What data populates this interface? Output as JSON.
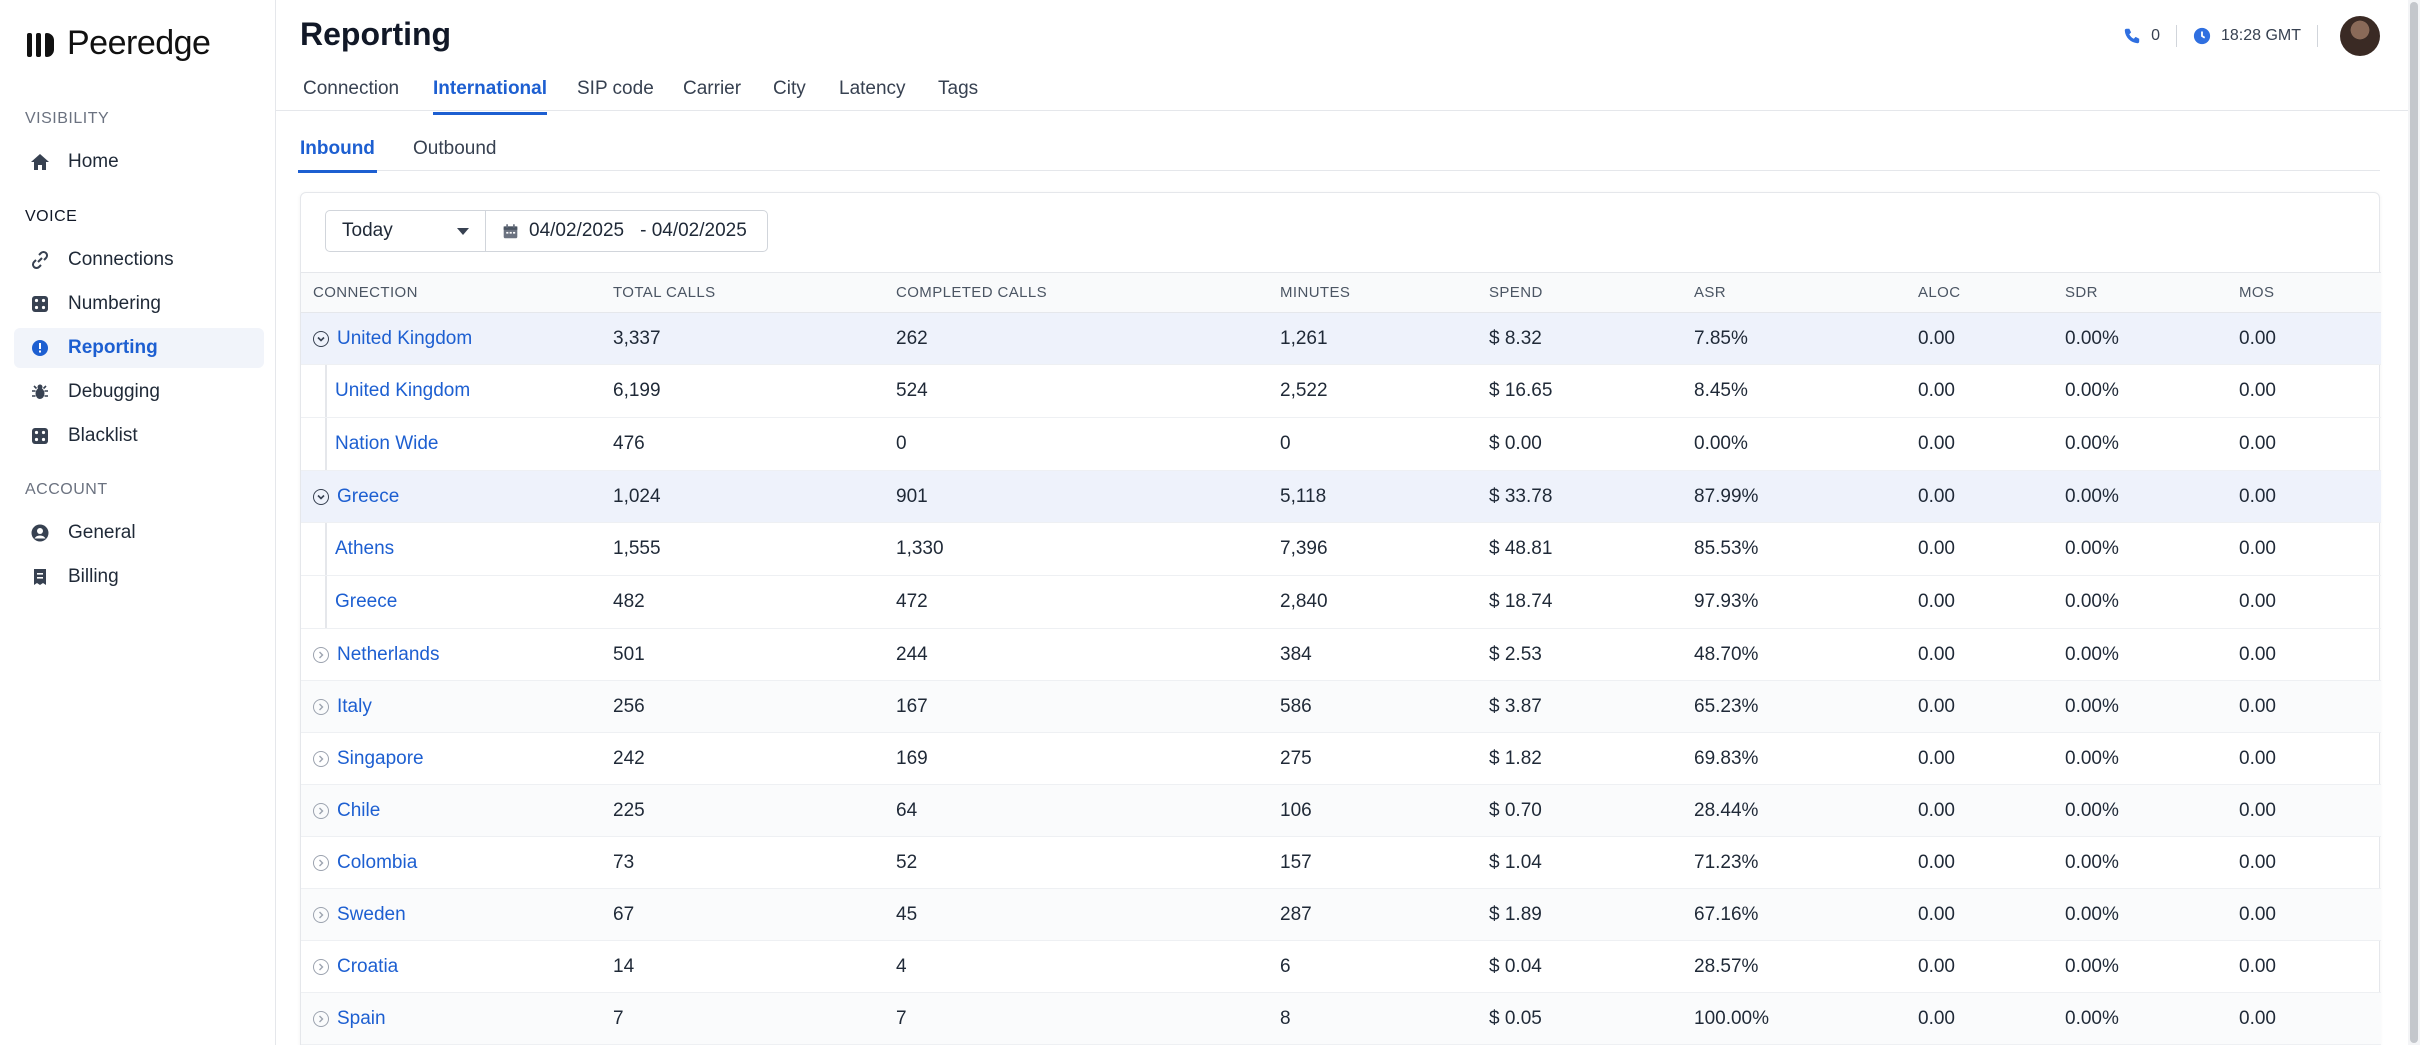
{
  "app": {
    "name": "Peeredge"
  },
  "sidebar": {
    "sections": [
      {
        "label": "VISIBILITY",
        "items": [
          {
            "label": "Home",
            "icon": "home-icon"
          }
        ]
      },
      {
        "label": "VOICE",
        "items": [
          {
            "label": "Connections",
            "icon": "link-icon"
          },
          {
            "label": "Numbering",
            "icon": "dice-icon"
          },
          {
            "label": "Reporting",
            "icon": "alert-circle-icon",
            "active": true
          },
          {
            "label": "Debugging",
            "icon": "bug-icon"
          },
          {
            "label": "Blacklist",
            "icon": "dice-icon"
          }
        ]
      },
      {
        "label": "ACCOUNT",
        "items": [
          {
            "label": "General",
            "icon": "user-circle-icon"
          },
          {
            "label": "Billing",
            "icon": "receipt-icon"
          }
        ]
      }
    ]
  },
  "header": {
    "title": "Reporting",
    "calls_count": "0",
    "time": "18:28 GMT"
  },
  "tabs": [
    {
      "label": "Connection"
    },
    {
      "label": "International",
      "active": true
    },
    {
      "label": "SIP code"
    },
    {
      "label": "Carrier"
    },
    {
      "label": "City"
    },
    {
      "label": "Latency"
    },
    {
      "label": "Tags"
    }
  ],
  "subtabs": [
    {
      "label": "Inbound",
      "active": true
    },
    {
      "label": "Outbound"
    }
  ],
  "filters": {
    "period": "Today",
    "date_from": "04/02/2025",
    "date_to": "- 04/02/2025"
  },
  "table": {
    "columns": [
      "Connection",
      "Total Calls",
      "Completed Calls",
      "Minutes",
      "Spend",
      "ASR",
      "ALOC",
      "SDR",
      "MOS"
    ],
    "rows": [
      {
        "kind": "parent",
        "expanded": true,
        "cells": [
          "United Kingdom",
          "3,337",
          "262",
          "1,261",
          "$ 8.32",
          "7.85%",
          "0.00",
          "0.00%",
          "0.00"
        ]
      },
      {
        "kind": "child",
        "cells": [
          "United Kingdom",
          "6,199",
          "524",
          "2,522",
          "$ 16.65",
          "8.45%",
          "0.00",
          "0.00%",
          "0.00"
        ]
      },
      {
        "kind": "child",
        "cells": [
          "Nation Wide",
          "476",
          "0",
          "0",
          "$ 0.00",
          "0.00%",
          "0.00",
          "0.00%",
          "0.00"
        ]
      },
      {
        "kind": "parent",
        "expanded": true,
        "cells": [
          "Greece",
          "1,024",
          "901",
          "5,118",
          "$ 33.78",
          "87.99%",
          "0.00",
          "0.00%",
          "0.00"
        ]
      },
      {
        "kind": "child",
        "cells": [
          "Athens",
          "1,555",
          "1,330",
          "7,396",
          "$ 48.81",
          "85.53%",
          "0.00",
          "0.00%",
          "0.00"
        ]
      },
      {
        "kind": "child",
        "cells": [
          "Greece",
          "482",
          "472",
          "2,840",
          "$ 18.74",
          "97.93%",
          "0.00",
          "0.00%",
          "0.00"
        ]
      },
      {
        "kind": "parent",
        "expanded": false,
        "cells": [
          "Netherlands",
          "501",
          "244",
          "384",
          "$ 2.53",
          "48.70%",
          "0.00",
          "0.00%",
          "0.00"
        ]
      },
      {
        "kind": "parent",
        "expanded": false,
        "cells": [
          "Italy",
          "256",
          "167",
          "586",
          "$ 3.87",
          "65.23%",
          "0.00",
          "0.00%",
          "0.00"
        ]
      },
      {
        "kind": "parent",
        "expanded": false,
        "cells": [
          "Singapore",
          "242",
          "169",
          "275",
          "$ 1.82",
          "69.83%",
          "0.00",
          "0.00%",
          "0.00"
        ]
      },
      {
        "kind": "parent",
        "expanded": false,
        "cells": [
          "Chile",
          "225",
          "64",
          "106",
          "$ 0.70",
          "28.44%",
          "0.00",
          "0.00%",
          "0.00"
        ]
      },
      {
        "kind": "parent",
        "expanded": false,
        "cells": [
          "Colombia",
          "73",
          "52",
          "157",
          "$ 1.04",
          "71.23%",
          "0.00",
          "0.00%",
          "0.00"
        ]
      },
      {
        "kind": "parent",
        "expanded": false,
        "cells": [
          "Sweden",
          "67",
          "45",
          "287",
          "$ 1.89",
          "67.16%",
          "0.00",
          "0.00%",
          "0.00"
        ]
      },
      {
        "kind": "parent",
        "expanded": false,
        "cells": [
          "Croatia",
          "14",
          "4",
          "6",
          "$ 0.04",
          "28.57%",
          "0.00",
          "0.00%",
          "0.00"
        ]
      },
      {
        "kind": "parent",
        "expanded": false,
        "cells": [
          "Spain",
          "7",
          "7",
          "8",
          "$ 0.05",
          "100.00%",
          "0.00",
          "0.00%",
          "0.00"
        ]
      }
    ]
  },
  "colors": {
    "accent": "#1d5fd1",
    "expanded_row_bg": "#eef2fb",
    "active_nav_bg": "#f1f4fa"
  }
}
